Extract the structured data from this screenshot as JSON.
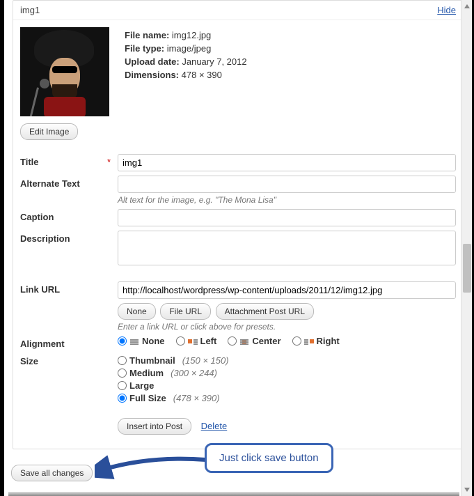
{
  "header": {
    "title": "img1",
    "hide": "Hide"
  },
  "meta": {
    "file_name_label": "File name:",
    "file_name": "img12.jpg",
    "file_type_label": "File type:",
    "file_type": "image/jpeg",
    "upload_date_label": "Upload date:",
    "upload_date": "January 7, 2012",
    "dimensions_label": "Dimensions:",
    "dimensions": "478 × 390"
  },
  "edit_image": "Edit Image",
  "fields": {
    "title": {
      "label": "Title",
      "value": "img1",
      "required": "*"
    },
    "alt": {
      "label": "Alternate Text",
      "value": "",
      "help": "Alt text for the image, e.g. \"The Mona Lisa\""
    },
    "caption": {
      "label": "Caption",
      "value": ""
    },
    "description": {
      "label": "Description",
      "value": ""
    },
    "link": {
      "label": "Link URL",
      "value": "http://localhost/wordpress/wp-content/uploads/2011/12/img12.jpg",
      "buttons": {
        "none": "None",
        "file": "File URL",
        "post": "Attachment Post URL"
      },
      "help": "Enter a link URL or click above for presets."
    },
    "alignment": {
      "label": "Alignment",
      "options": {
        "none": "None",
        "left": "Left",
        "center": "Center",
        "right": "Right"
      },
      "selected": "none"
    },
    "size": {
      "label": "Size",
      "options": [
        {
          "key": "thumbnail",
          "label": "Thumbnail",
          "dim": "(150 × 150)"
        },
        {
          "key": "medium",
          "label": "Medium",
          "dim": "(300 × 244)"
        },
        {
          "key": "large",
          "label": "Large",
          "dim": ""
        },
        {
          "key": "full",
          "label": "Full Size",
          "dim": "(478 × 390)"
        }
      ],
      "selected": "full"
    }
  },
  "actions": {
    "insert": "Insert into Post",
    "delete": "Delete",
    "save": "Save all changes"
  },
  "annotation": "Just click  save button"
}
